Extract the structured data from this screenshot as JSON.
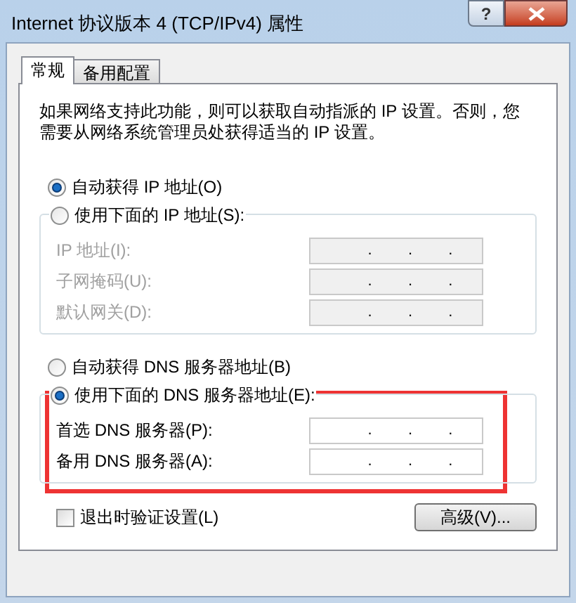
{
  "window": {
    "title": "Internet 协议版本 4 (TCP/IPv4) 属性",
    "help": "?"
  },
  "tabs": [
    {
      "label": "常规",
      "selected": true
    },
    {
      "label": "备用配置",
      "selected": false
    }
  ],
  "intro": "如果网络支持此功能，则可以获取自动指派的 IP 设置。否则，您需要从网络系统管理员处获得适当的 IP 设置。",
  "ip_auto": {
    "label": "自动获得 IP 地址(O)",
    "selected": true
  },
  "ip_manual": {
    "label": "使用下面的 IP 地址(S):",
    "selected": false,
    "fields": [
      {
        "label": "IP 地址(I):",
        "disabled": true,
        "separators": [
          ".",
          ".",
          "."
        ]
      },
      {
        "label": "子网掩码(U):",
        "disabled": true,
        "separators": [
          ".",
          ".",
          "."
        ]
      },
      {
        "label": "默认网关(D):",
        "disabled": true,
        "separators": [
          ".",
          ".",
          "."
        ]
      }
    ]
  },
  "dns_auto": {
    "label": "自动获得 DNS 服务器地址(B)",
    "selected": false
  },
  "dns_manual": {
    "label": "使用下面的 DNS 服务器地址(E):",
    "selected": true,
    "highlighted": true,
    "fields": [
      {
        "label": "首选 DNS 服务器(P):",
        "disabled": false,
        "separators": [
          ".",
          ".",
          "."
        ]
      },
      {
        "label": "备用 DNS 服务器(A):",
        "disabled": false,
        "separators": [
          ".",
          ".",
          "."
        ]
      }
    ]
  },
  "validate": {
    "label": "退出时验证设置(L)",
    "checked": false
  },
  "advanced_button": "高级(V)..."
}
